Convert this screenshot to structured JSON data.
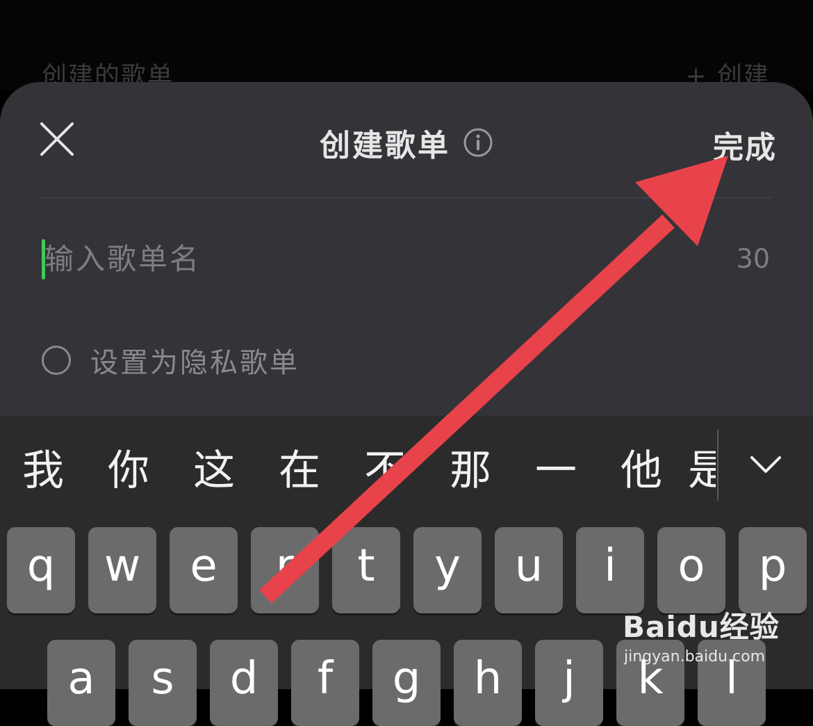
{
  "background": {
    "section_title": "创建的歌单",
    "create_label": "+ 创建"
  },
  "sheet": {
    "title": "创建歌单",
    "done_label": "完成",
    "name_input": {
      "placeholder": "输入歌单名",
      "value": ""
    },
    "char_limit": "30",
    "privacy_label": "设置为隐私歌单",
    "privacy_checked": false
  },
  "keyboard": {
    "candidates": [
      "我",
      "你",
      "这",
      "在",
      "不",
      "那",
      "一",
      "他",
      "是"
    ],
    "row1": [
      "q",
      "w",
      "e",
      "r",
      "t",
      "y",
      "u",
      "i",
      "o",
      "p"
    ],
    "row2": [
      "a",
      "s",
      "d",
      "f",
      "g",
      "h",
      "j",
      "k",
      "l"
    ]
  },
  "watermark": {
    "logo": "Baidu经验",
    "url": "jingyan.baidu.com"
  },
  "colors": {
    "sheet_bg": "#343338",
    "caret": "#3dcc5a",
    "arrow": "#e8434a",
    "key_bg": "#6b6b6b"
  },
  "icons": {
    "close": "close-icon",
    "info": "info-icon",
    "collapse": "chevron-down-icon"
  }
}
